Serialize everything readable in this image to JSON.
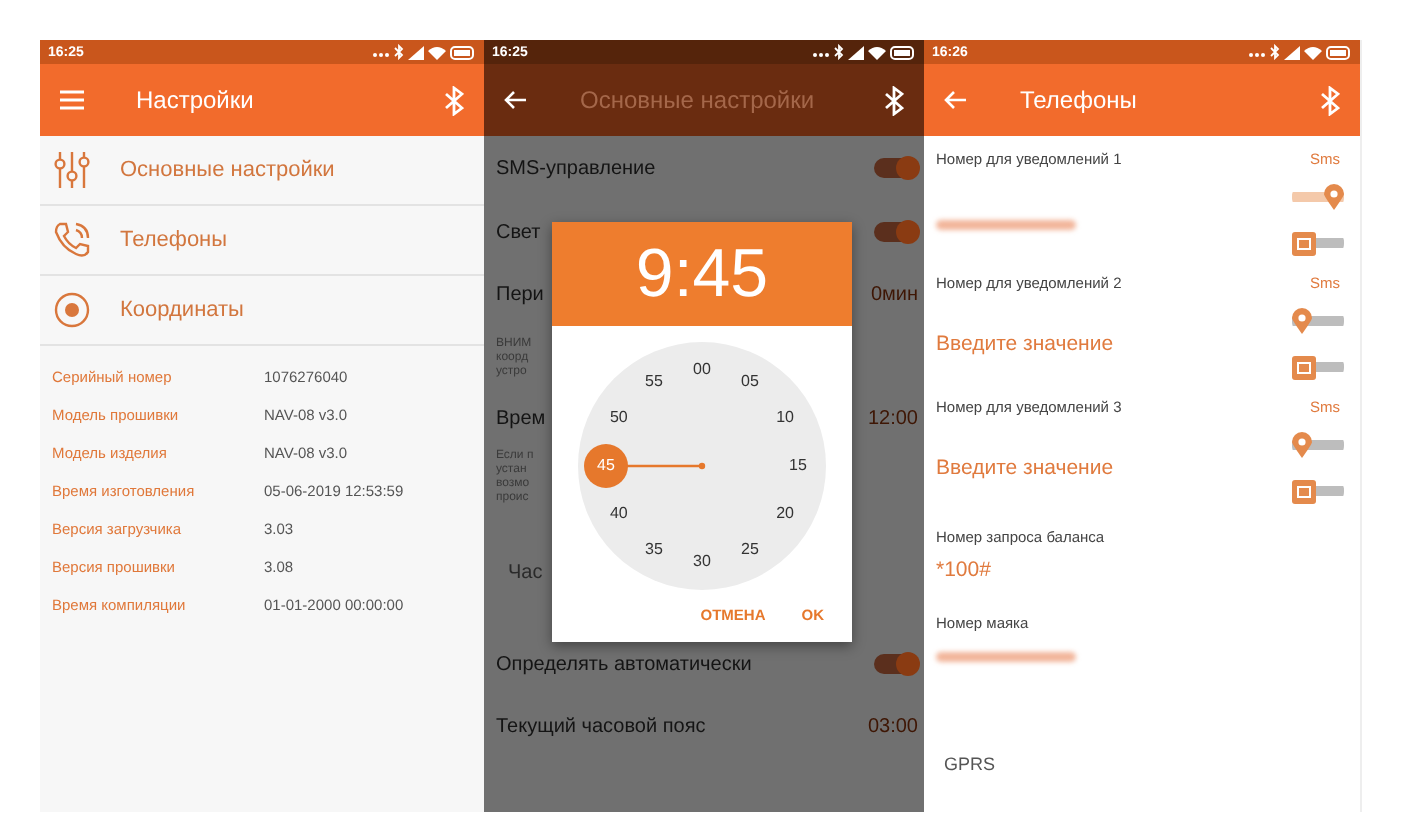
{
  "settings_screen": {
    "status_time": "16:25",
    "title": "Настройки",
    "menu_items": [
      {
        "label": "Основные настройки"
      },
      {
        "label": "Телефоны"
      },
      {
        "label": "Координаты"
      }
    ],
    "info_rows": [
      {
        "label": "Серийный номер",
        "value": "1076276040"
      },
      {
        "label": "Модель прошивки",
        "value": "NAV-08 v3.0"
      },
      {
        "label": "Модель изделия",
        "value": "NAV-08 v3.0"
      },
      {
        "label": "Время изготовления",
        "value": "05-06-2019 12:53:59"
      },
      {
        "label": "Версия загрузчика",
        "value": "3.03"
      },
      {
        "label": "Версия прошивки",
        "value": "3.08"
      },
      {
        "label": "Время компиляции",
        "value": "01-01-2000 00:00:00"
      }
    ]
  },
  "basic_settings_screen": {
    "status_time": "16:25",
    "title": "Основные настройки",
    "rows": [
      {
        "kind": "toggle",
        "label": "SMS-управление",
        "on": true
      },
      {
        "kind": "toggle",
        "label": "Свет",
        "on": true
      },
      {
        "kind": "value",
        "label": "Пери",
        "value": "0мин"
      },
      {
        "kind": "note",
        "lines": [
          "ВНИМ",
          "коорд",
          "устро"
        ]
      },
      {
        "kind": "value",
        "label": "Врем",
        "value": "12:00"
      },
      {
        "kind": "note",
        "lines": [
          "Если п",
          "устан",
          "возмо",
          "проис"
        ]
      },
      {
        "kind": "section",
        "label": "Час"
      },
      {
        "kind": "toggle",
        "label": "Определять автоматически",
        "on": true
      },
      {
        "kind": "value",
        "label": "Текущий часовой пояс",
        "value": "03:00"
      }
    ],
    "time_dialog": {
      "time": "9:45",
      "minutes": [
        {
          "label": "00",
          "selected": false
        },
        {
          "label": "05",
          "selected": false
        },
        {
          "label": "10",
          "selected": false
        },
        {
          "label": "15",
          "selected": false
        },
        {
          "label": "20",
          "selected": false
        },
        {
          "label": "25",
          "selected": false
        },
        {
          "label": "30",
          "selected": false
        },
        {
          "label": "35",
          "selected": false
        },
        {
          "label": "40",
          "selected": false
        },
        {
          "label": "45",
          "selected": true
        },
        {
          "label": "50",
          "selected": false
        },
        {
          "label": "55",
          "selected": false
        }
      ],
      "buttons": [
        "ОТМЕНА",
        "OK"
      ]
    }
  },
  "phones_screen": {
    "status_time": "16:26",
    "title": "Телефоны",
    "notify_numbers": [
      {
        "label": "Номер для уведомлений 1",
        "sms": "Sms",
        "value_hidden": true,
        "location_on": true,
        "wallet_on": false
      },
      {
        "label": "Номер для уведомлений 2",
        "sms": "Sms",
        "placeholder": "Введите значение",
        "location_on": false,
        "wallet_on": false
      },
      {
        "label": "Номер для уведомлений 3",
        "sms": "Sms",
        "placeholder": "Введите значение",
        "location_on": false,
        "wallet_on": false
      }
    ],
    "balance": {
      "label": "Номер запроса баланса",
      "value": "*100#"
    },
    "beacon": {
      "label": "Номер маяка",
      "value_hidden": true
    },
    "section": "GPRS"
  }
}
